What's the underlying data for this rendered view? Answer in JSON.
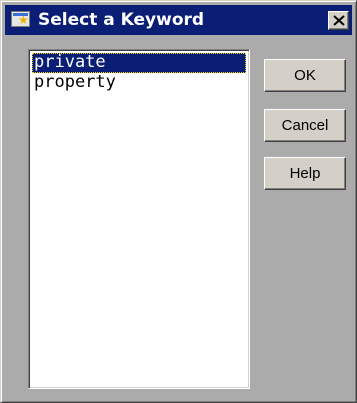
{
  "window": {
    "title": "Select a Keyword",
    "icon": "app-icon",
    "close_icon": "close-icon"
  },
  "keyword_list": {
    "items": [
      {
        "label": "private",
        "selected": true
      },
      {
        "label": "property",
        "selected": false
      }
    ]
  },
  "buttons": {
    "ok_label": "OK",
    "cancel_label": "Cancel",
    "help_label": "Help"
  },
  "colors": {
    "titlebar": "#0a1e76",
    "selection": "#0a1e76",
    "dialog_background": "#ababab",
    "button_face": "#d4d0c8"
  }
}
